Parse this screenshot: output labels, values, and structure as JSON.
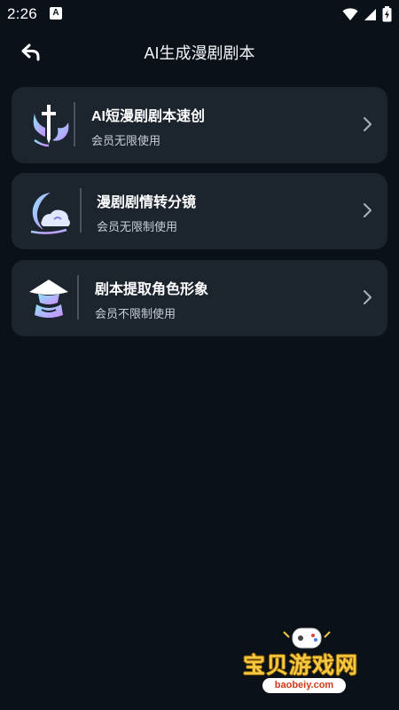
{
  "status_bar": {
    "time": "2:26",
    "app_badge": "A"
  },
  "header": {
    "title": "AI生成漫剧剧本"
  },
  "cards": [
    {
      "title": "AI短漫剧剧本速创",
      "subtitle": "会员无限使用",
      "icon": "sword-shield-icon"
    },
    {
      "title": "漫剧剧情转分镜",
      "subtitle": "会员无限制使用",
      "icon": "moon-cloud-icon"
    },
    {
      "title": "剧本提取角色形象",
      "subtitle": "会员不限制使用",
      "icon": "hat-character-icon"
    }
  ],
  "watermark": {
    "name": "宝贝游戏网",
    "url": "baobeiy.com"
  },
  "colors": {
    "background": "#0b1119",
    "card": "#1c242e",
    "accent_gradient": [
      "#7fd7f5",
      "#c77dff"
    ]
  }
}
